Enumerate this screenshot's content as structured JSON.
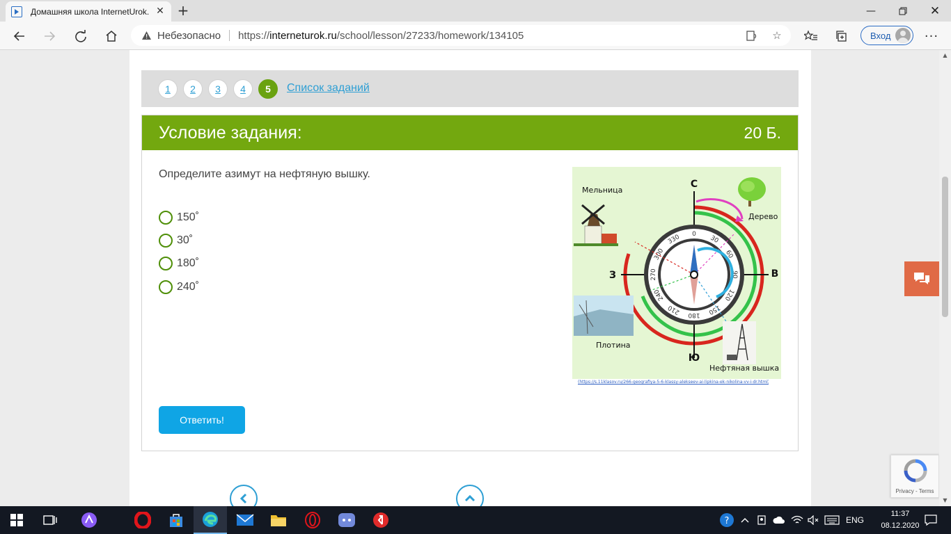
{
  "browser": {
    "tab_title": "Домашняя школа InternetUrok.ru",
    "security_label": "Небезопасно",
    "url_prefix": "https://",
    "url_domain": "interneturok.ru",
    "url_path": "/school/lesson/27233/homework/134105",
    "profile_label": "Вход"
  },
  "pager": {
    "pages": [
      "1",
      "2",
      "3",
      "4",
      "5"
    ],
    "active_page": "5",
    "task_list_label": "Список заданий"
  },
  "task": {
    "title": "Условие задания:",
    "points": "20 Б.",
    "question": "Определите азимут на нефтяную вышку.",
    "options": [
      "150˚",
      "30˚",
      "180˚",
      "240˚"
    ],
    "submit_label": "Ответить!"
  },
  "figure": {
    "north": "С",
    "south": "Ю",
    "west": "З",
    "east": "В",
    "mill": "Мельница",
    "tree": "Дерево",
    "dam": "Плотина",
    "oil_rig": "Нефтяная вышка",
    "dial": [
      "0",
      "30",
      "60",
      "90",
      "120",
      "150",
      "180",
      "210",
      "240",
      "270",
      "300",
      "330"
    ],
    "source_link": "(https://s.11klasov.ru/266-geografiya-5-6-klassy-alekseev-ai-lipkina-ek-nikolina-vv-i-dr.html)"
  },
  "recaptcha": {
    "links": "Privacy - Terms"
  },
  "taskbar": {
    "language": "ENG",
    "time": "11:37",
    "date": "08.12.2020"
  },
  "colors": {
    "accent_green": "#73a80f",
    "link_blue": "#2e9fd4",
    "button_blue": "#0fa5e5",
    "feedback_orange": "#e06a46"
  }
}
